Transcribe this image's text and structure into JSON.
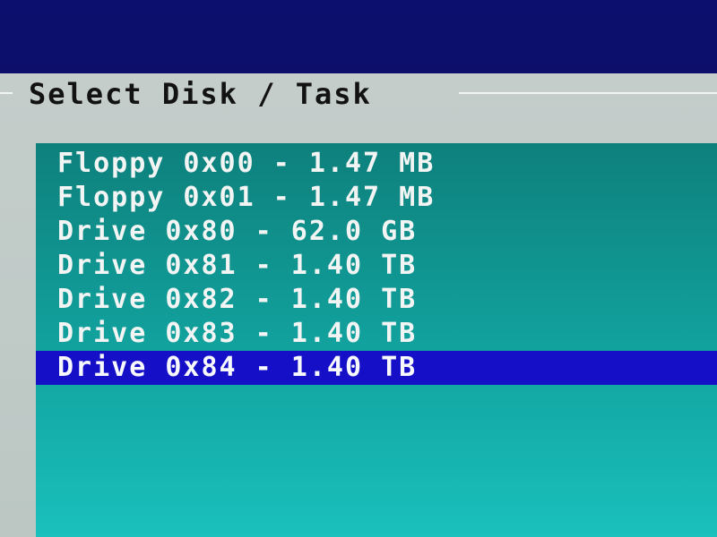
{
  "dialog": {
    "title": "Select Disk / Task"
  },
  "disks": {
    "items": [
      {
        "label": "Floppy 0x00 - 1.47 MB",
        "selected": false
      },
      {
        "label": "Floppy 0x01 - 1.47 MB",
        "selected": false
      },
      {
        "label": "Drive 0x80 - 62.0 GB",
        "selected": false
      },
      {
        "label": "Drive 0x81 - 1.40 TB",
        "selected": false
      },
      {
        "label": "Drive 0x82 - 1.40 TB",
        "selected": false
      },
      {
        "label": "Drive 0x83 - 1.40 TB",
        "selected": false
      },
      {
        "label": "Drive 0x84 - 1.40 TB",
        "selected": true
      }
    ]
  },
  "colors": {
    "background": "#0d0f6e",
    "dialog_frame": "#c4cdca",
    "list_background": "#12a4a0",
    "highlight": "#1510c8",
    "item_text": "#f2f5f3",
    "title_text": "#121212"
  }
}
